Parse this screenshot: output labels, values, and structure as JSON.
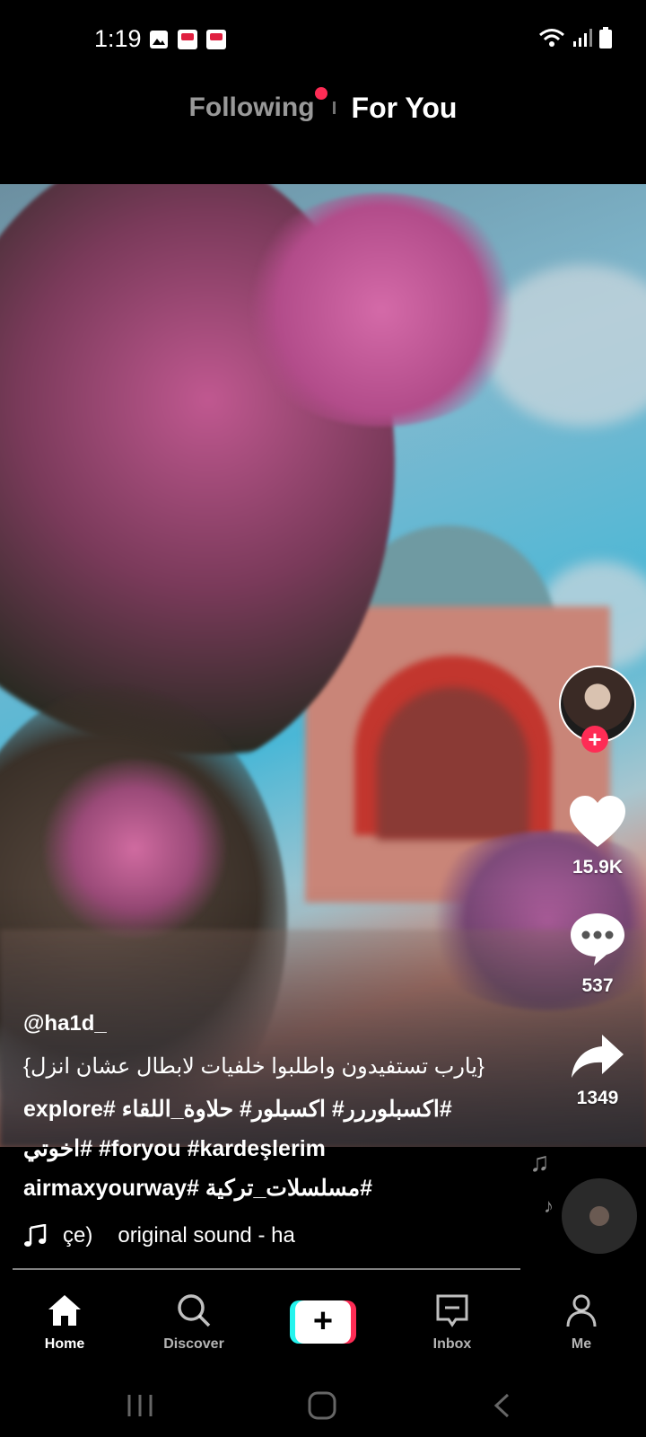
{
  "status": {
    "time": "1:19"
  },
  "tabs": {
    "following": "Following",
    "for_you": "For You"
  },
  "video": {
    "username": "@ha1d_",
    "caption_lines": [
      "{يارب تستفيدون واطلبوا خلفيات لابطال عشان انزل}",
      "explore# اكسبلوررر# اكسبلور# حلاوة_اللقاء#",
      "اخوتي# #foryou #kardeşlerim",
      "airmaxyourway# مسلسلات_تركية#"
    ],
    "sound_prefix": "çe)",
    "sound": "original sound - ha",
    "likes": "15.9K",
    "comments": "537",
    "shares": "1349"
  },
  "nav": {
    "home": "Home",
    "discover": "Discover",
    "inbox": "Inbox",
    "me": "Me"
  },
  "colors": {
    "accent": "#fe2c55",
    "cyan": "#25f4ee"
  }
}
